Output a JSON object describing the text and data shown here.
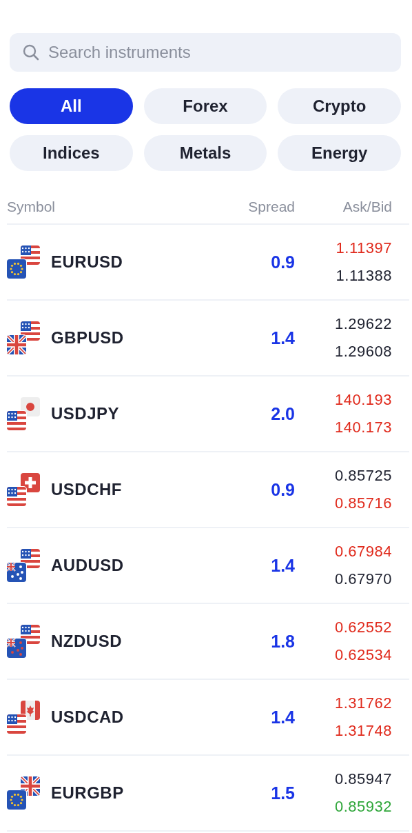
{
  "search": {
    "placeholder": "Search instruments"
  },
  "filters": [
    {
      "label": "All",
      "selected": true
    },
    {
      "label": "Forex",
      "selected": false
    },
    {
      "label": "Crypto",
      "selected": false
    },
    {
      "label": "Indices",
      "selected": false
    },
    {
      "label": "Metals",
      "selected": false
    },
    {
      "label": "Energy",
      "selected": false
    }
  ],
  "table": {
    "columns": [
      "Symbol",
      "Spread",
      "Ask/Bid"
    ],
    "rows": [
      {
        "symbol": "EURUSD",
        "spread": "0.9",
        "ask": {
          "value": "1.11397",
          "color": "#e02a1c"
        },
        "bid": {
          "value": "1.11388",
          "color": "#1f2230"
        }
      },
      {
        "symbol": "GBPUSD",
        "spread": "1.4",
        "ask": {
          "value": "1.29622",
          "color": "#1f2230"
        },
        "bid": {
          "value": "1.29608",
          "color": "#1f2230"
        }
      },
      {
        "symbol": "USDJPY",
        "spread": "2.0",
        "ask": {
          "value": "140.193",
          "color": "#e02a1c"
        },
        "bid": {
          "value": "140.173",
          "color": "#e02a1c"
        }
      },
      {
        "symbol": "USDCHF",
        "spread": "0.9",
        "ask": {
          "value": "0.85725",
          "color": "#1f2230"
        },
        "bid": {
          "value": "0.85716",
          "color": "#e02a1c"
        }
      },
      {
        "symbol": "AUDUSD",
        "spread": "1.4",
        "ask": {
          "value": "0.67984",
          "color": "#e02a1c"
        },
        "bid": {
          "value": "0.67970",
          "color": "#1f2230"
        }
      },
      {
        "symbol": "NZDUSD",
        "spread": "1.8",
        "ask": {
          "value": "0.62552",
          "color": "#e02a1c"
        },
        "bid": {
          "value": "0.62534",
          "color": "#e02a1c"
        }
      },
      {
        "symbol": "USDCAD",
        "spread": "1.4",
        "ask": {
          "value": "1.31762",
          "color": "#e02a1c"
        },
        "bid": {
          "value": "1.31748",
          "color": "#e02a1c"
        }
      },
      {
        "symbol": "EURGBP",
        "spread": "1.5",
        "ask": {
          "value": "0.85947",
          "color": "#1f2230"
        },
        "bid": {
          "value": "0.85932",
          "color": "#2fa63a"
        }
      }
    ]
  }
}
